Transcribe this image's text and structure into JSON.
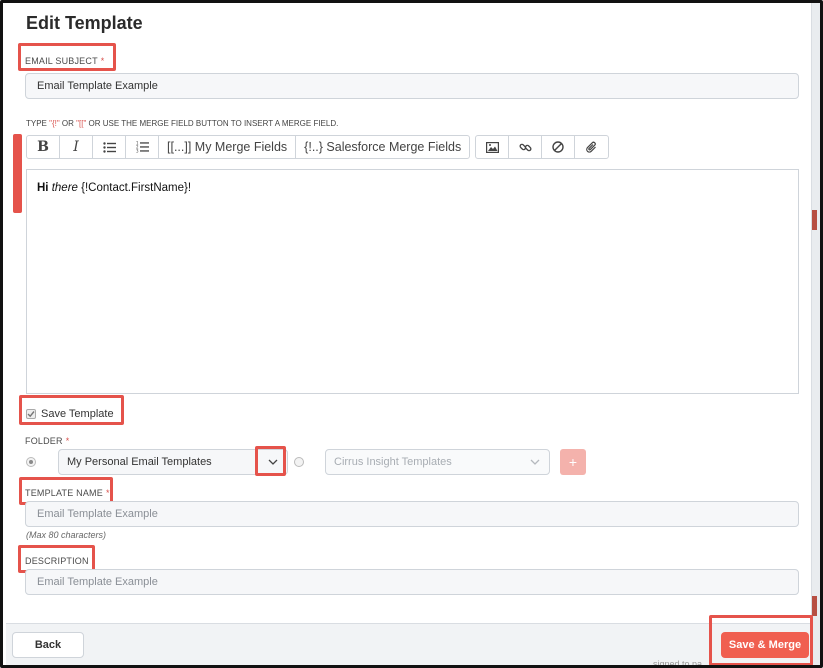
{
  "title": "Edit Template",
  "email_subject": {
    "label": "EMAIL SUBJECT",
    "required_mark": "*",
    "value": "Email Template Example"
  },
  "merge_hint": {
    "prefix": "TYPE ",
    "token1": "\"{!\"",
    "middle": " OR ",
    "token2": "\"[[\"",
    "suffix": " OR USE THE MERGE FIELD BUTTON TO INSERT A MERGE FIELD."
  },
  "toolbar": {
    "bold": "B",
    "italic": "I",
    "my_merge_fields": "[[...]] My Merge Fields",
    "salesforce_merge_fields": "{!..} Salesforce Merge Fields"
  },
  "editor": {
    "bold_part": "Hi",
    "italic_part": "there",
    "rest": "{!Contact.FirstName}!"
  },
  "save_template": {
    "label": "Save Template",
    "checked": true
  },
  "folder": {
    "label": "FOLDER",
    "required_mark": "*",
    "personal_value": "My Personal Email Templates",
    "cirrus_value": "Cirrus Insight Templates",
    "add_label": "+"
  },
  "template_name": {
    "label": "TEMPLATE NAME",
    "required_mark": "*",
    "placeholder": "Email Template Example",
    "hint": "(Max 80 characters)"
  },
  "description": {
    "label": "DESCRIPTION",
    "required_mark": "*",
    "placeholder": "Email Template Example"
  },
  "footer": {
    "back_label": "Back",
    "save_merge_label": "Save & Merge",
    "background_text": "signed to pa"
  },
  "colors": {
    "accent": "#f05f50",
    "highlight": "#e5534b",
    "required": "#d9534f"
  }
}
